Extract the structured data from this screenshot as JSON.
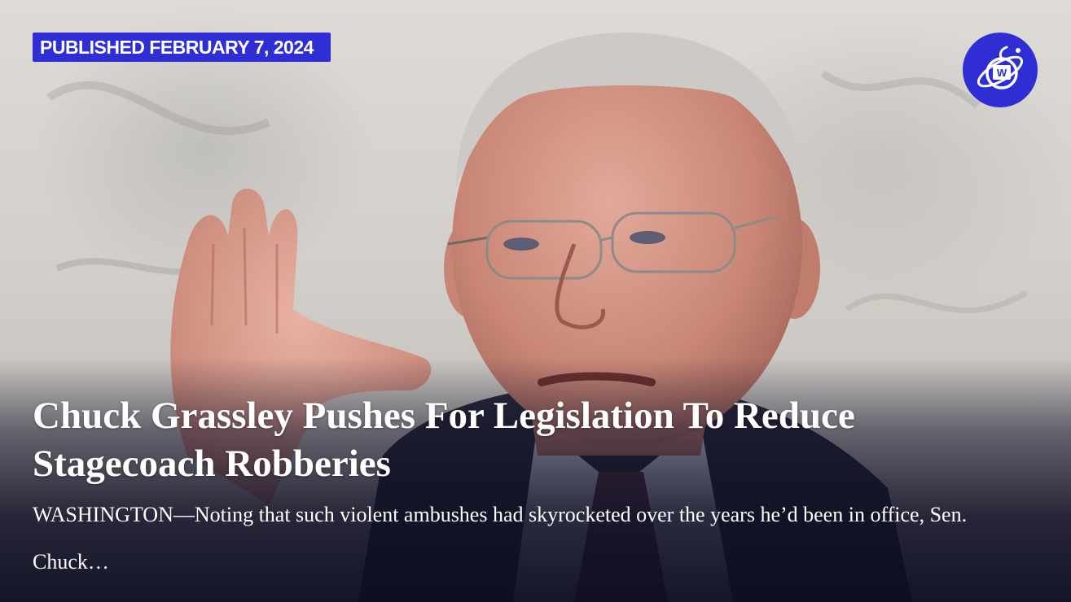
{
  "article": {
    "published_label": "PUBLISHED FEBRUARY 7, 2024",
    "headline": "Chuck Grassley Pushes For Legislation To Reduce Stagecoach Robberies",
    "dek": "WASHINGTON—Noting that such violent ambushes had skyrocketed over the years he’d been in office, Sen. Chuck…",
    "photo_icon": "article-photo",
    "logo_icon": "onion-w-logo-icon"
  },
  "colors": {
    "accent": "#2f2dd4",
    "text": "#ffffff",
    "overlay": "#14142d"
  }
}
